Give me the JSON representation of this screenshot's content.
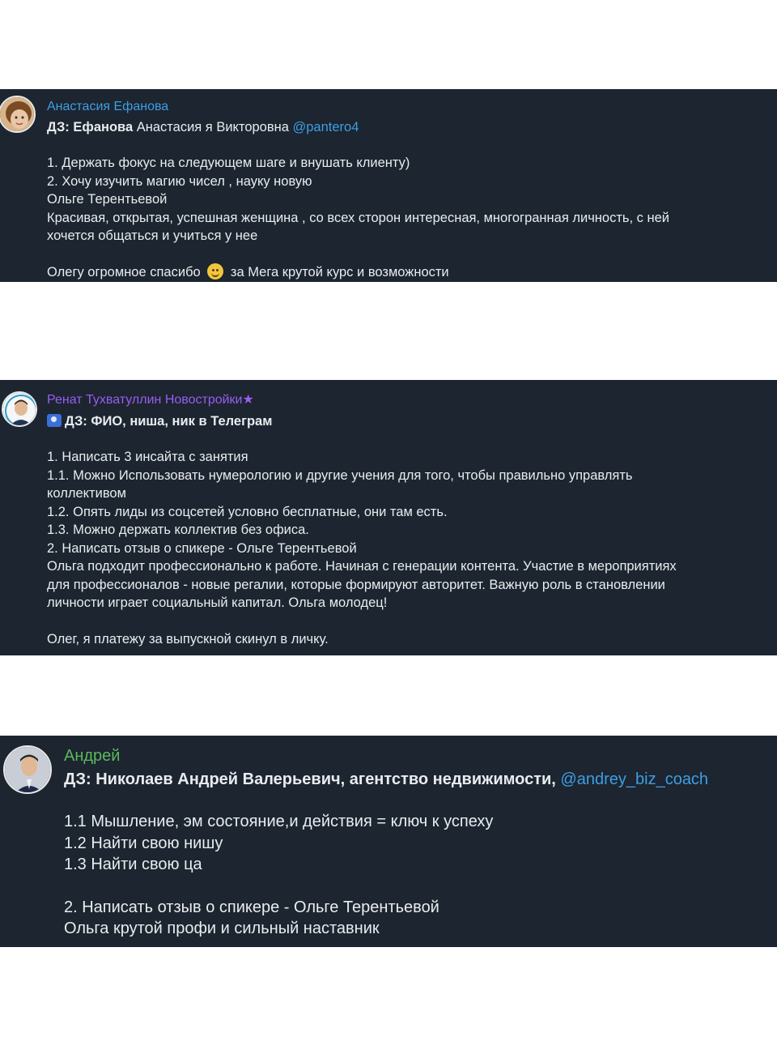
{
  "messages": [
    {
      "sender": "Анастасия Ефанова",
      "title_bold": "ДЗ: Ефанова",
      "title_rest": " Анастасия я Викторовна ",
      "mention": "@pantero4",
      "lines": [
        "1. Держать фокус на следующем шаге и внушать клиенту)",
        "2. Хочу изучить магию чисел , науку новую",
        "Ольге Терентьевой",
        "Красивая, открытая, успешная женщина , со всех сторон интересная, многогранная личность, с ней",
        "хочется общаться и учиться у нее"
      ],
      "closing_before": "Олегу огромное спасибо ",
      "closing_after": " за Мега крутой курс и возможности"
    },
    {
      "sender": "Ренат Тухватуллин Новостройки",
      "sender_star": "★",
      "title": "ДЗ: ФИО, ниша, ник в Телеграм",
      "lines": [
        "1. Написать 3 инсайта с занятия",
        "1.1. Можно Использовать нумерологию и другие учения для того, чтобы правильно управлять",
        "коллективом",
        "1.2. Опять лиды из соцсетей условно бесплатные, они там есть.",
        "1.3. Можно держать коллектив без офиса.",
        "2. Написать отзыв о спикере - Ольге Терентьевой",
        "Ольга подходит профессионально к работе. Начиная с генерации контента. Участие в мероприятиях",
        "для профессионалов - новые регалии, которые формируют авторитет. Важную роль в становлении",
        "личности играет социальный капитал. Ольга молодец!"
      ],
      "closing": "Олег, я платежу за выпускной скинул в личку."
    },
    {
      "sender": "Андрей",
      "title": "ДЗ: Николаев Андрей Валерьевич, агентство недвижимости, ",
      "mention": "@andrey_biz_coach",
      "lines_a": [
        "1.1 Мышление, эм состояние,и действия  = ключ к успеху",
        "1.2 Найти свою нишу",
        "1.3 Найти свою ца"
      ],
      "lines_b": [
        "2. Написать отзыв о спикере - Ольге Терентьевой",
        "Ольга крутой профи и сильный наставник"
      ]
    }
  ],
  "colors": {
    "card_bg": "#1c2530",
    "sender_1": "#3e9ee4",
    "sender_2": "#9b5cf0",
    "sender_3": "#5cb85c",
    "mention": "#3e9ee4",
    "text": "#e9ecef"
  }
}
